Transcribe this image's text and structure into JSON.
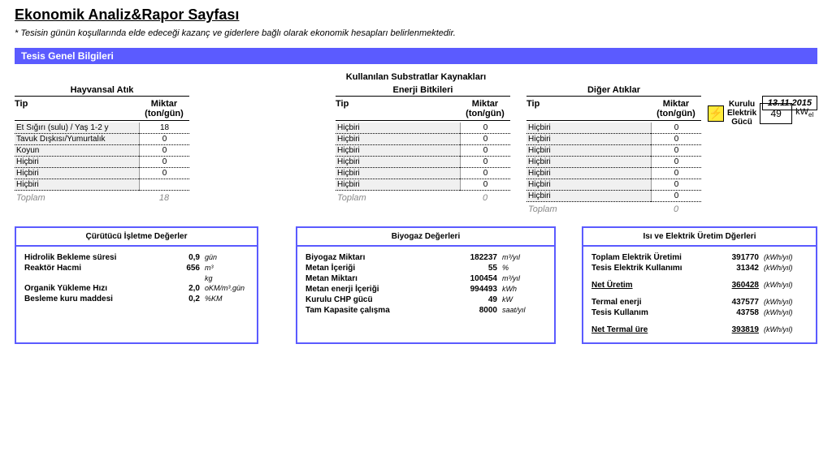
{
  "title": "Ekonomik Analiz&Rapor Sayfası",
  "subtitle": "* Tesisin günün koşullarında elde edeceği kazanç ve giderlere bağlı olarak ekonomik hesapları belirlenmektedir.",
  "section_bar": "Tesis Genel Bilgileri",
  "sources_header": "Kullanılan Substratlar Kaynakları",
  "date": "13.11.2015",
  "headers": {
    "tip": "Tip",
    "miktar": "Miktar (ton/gün)",
    "toplam": "Toplam"
  },
  "animal": {
    "title": "Hayvansal Atık",
    "rows": [
      {
        "tip": "Et Sığırı (sulu) / Yaş 1-2 y",
        "mik": "18"
      },
      {
        "tip": "Tavuk Dışkısı/Yumurtalık",
        "mik": "0"
      },
      {
        "tip": "Koyun",
        "mik": "0"
      },
      {
        "tip": "Hiçbiri",
        "mik": "0"
      },
      {
        "tip": "Hiçbiri",
        "mik": "0"
      },
      {
        "tip": "Hiçbiri",
        "mik": ""
      }
    ],
    "total": "18"
  },
  "energy": {
    "title": "Enerji Bitkileri",
    "rows": [
      {
        "tip": "Hiçbiri",
        "mik": "0"
      },
      {
        "tip": "Hiçbiri",
        "mik": "0"
      },
      {
        "tip": "Hiçbiri",
        "mik": "0"
      },
      {
        "tip": "Hiçbiri",
        "mik": "0"
      },
      {
        "tip": "Hiçbiri",
        "mik": "0"
      },
      {
        "tip": "Hiçbiri",
        "mik": "0"
      }
    ],
    "total": "0"
  },
  "other": {
    "title": "Diğer Atıklar",
    "rows": [
      {
        "tip": "Hiçbiri",
        "mik": "0"
      },
      {
        "tip": "Hiçbiri",
        "mik": "0"
      },
      {
        "tip": "Hiçbiri",
        "mik": "0"
      },
      {
        "tip": "Hiçbiri",
        "mik": "0"
      },
      {
        "tip": "Hiçbiri",
        "mik": "0"
      },
      {
        "tip": "Hiçbiri",
        "mik": "0"
      },
      {
        "tip": "Hiçbiri",
        "mik": "0"
      }
    ],
    "total": "0"
  },
  "power": {
    "label1": "Kurulu",
    "label2": "Elektrik",
    "label3": "Gücü",
    "value": "49",
    "unit": "kW",
    "unit_sub": "el"
  },
  "panels": {
    "digester": {
      "title": "Çürütücü İşletme Değerler",
      "rows": [
        {
          "label": "Hidrolik Bekleme süresi",
          "val": "0,9",
          "unit": "gün"
        },
        {
          "label": "Reaktör Hacmi",
          "val": "656",
          "unit": "m³"
        },
        {
          "label": "",
          "val": "",
          "unit": "kg"
        },
        {
          "label": "Organik Yükleme Hızı",
          "val": "2,0",
          "unit": "oKM/m³.gün"
        },
        {
          "label": "Besleme kuru maddesi",
          "val": "0,2",
          "unit": "%KM"
        }
      ]
    },
    "biogas": {
      "title": "Biyogaz Değerleri",
      "rows": [
        {
          "label": "Biyogaz Miktarı",
          "val": "182237",
          "unit": "m³/yıl"
        },
        {
          "label": "Metan İçeriği",
          "val": "55",
          "unit": "%"
        },
        {
          "label": "Metan Miktarı",
          "val": "100454",
          "unit": "m³/yıl"
        },
        {
          "label": "Metan enerji İçeriği",
          "val": "994493",
          "unit": "kWh"
        },
        {
          "label": "Kurulu CHP gücü",
          "val": "49",
          "unit": "kW"
        },
        {
          "label": "Tam Kapasite çalışma",
          "val": "8000",
          "unit": "saat/yıl"
        }
      ]
    },
    "heat": {
      "title": "Isı ve Elektrik Üretim Dğerleri",
      "rows": [
        {
          "label": "Toplam Elektrik Üretimi",
          "val": "391770",
          "unit": "(kWh/yıl)"
        },
        {
          "label": "Tesis Elektrik Kullanımı",
          "val": "31342",
          "unit": "(kWh/yıl)"
        },
        {
          "label": "Net Üretim",
          "val": "360428",
          "unit": "(kWh/yıl)",
          "ul": true
        },
        {
          "label": "Termal enerji",
          "val": "437577",
          "unit": "(kWh/yıl)"
        },
        {
          "label": "Tesis Kullanım",
          "val": "43758",
          "unit": "(kWh/yıl)"
        },
        {
          "label": "Net Termal üre",
          "val": "393819",
          "unit": "(kWh/yıl)",
          "ul": true
        }
      ]
    }
  }
}
